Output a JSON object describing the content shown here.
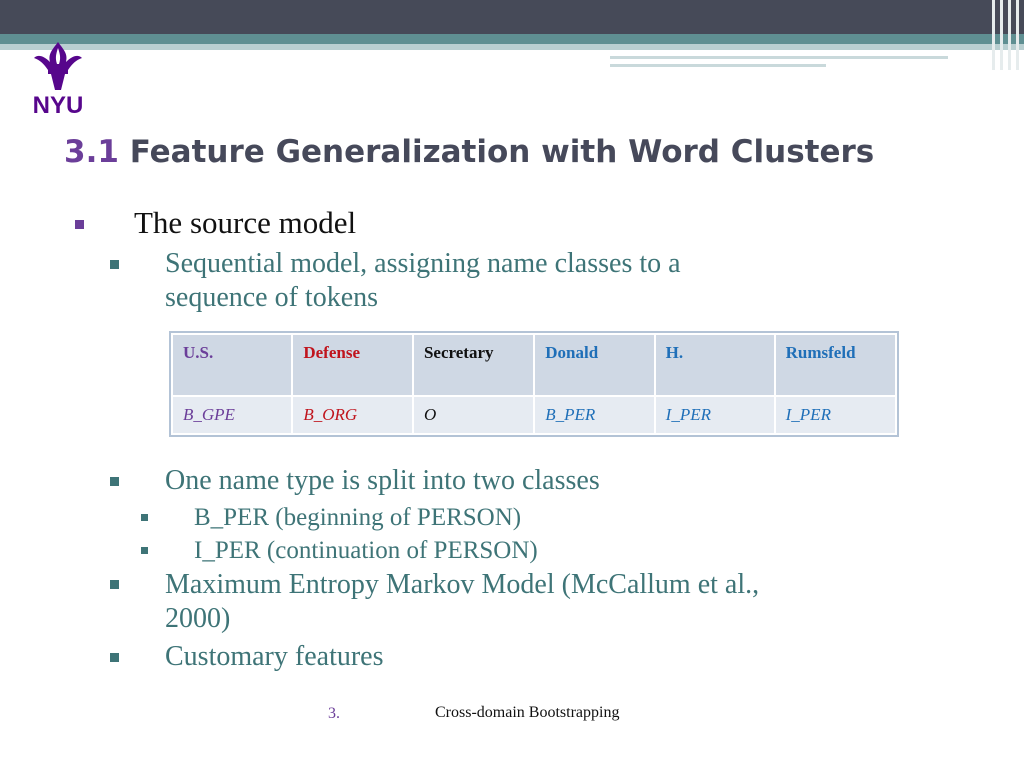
{
  "colors": {
    "purple": "#6b3e99",
    "teal": "#3e7477",
    "red": "#c0141d",
    "blue": "#1f6fb8",
    "nyu_violet": "#57068c"
  },
  "logo": {
    "text": "NYU",
    "icon": "torch-icon"
  },
  "title": {
    "number": "3.1",
    "text": "Feature Generalization with Word Clusters"
  },
  "bullets": {
    "b1": "The source model",
    "b2_line1": "Sequential model, assigning name classes to a",
    "b2_line2": "sequence of tokens",
    "b3": "One name type is split into two classes",
    "b3a": "B_PER (beginning of PERSON)",
    "b3b": "I_PER (continuation of PERSON)",
    "b4_line1": "Maximum Entropy Markov Model (McCallum et al.,",
    "b4_line2": "2000)",
    "b5": "Customary features"
  },
  "table": {
    "tokens": [
      "U.S.",
      "Defense",
      "Secretary",
      "Donald",
      "H.",
      "Rumsfeld"
    ],
    "tags": [
      "B_GPE",
      "B_ORG",
      "O",
      "B_PER",
      "I_PER",
      "I_PER"
    ]
  },
  "footer": {
    "page": "3.",
    "text": "Cross-domain Bootstrapping"
  }
}
